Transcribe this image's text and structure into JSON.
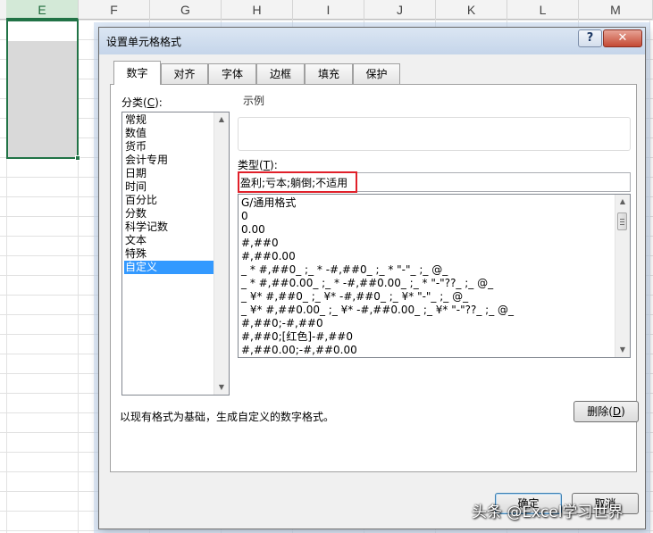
{
  "spreadsheet": {
    "columns": [
      "E",
      "F",
      "G",
      "H",
      "I",
      "J",
      "K",
      "L",
      "M"
    ],
    "selected_column": "E"
  },
  "dialog": {
    "title": "设置单元格格式",
    "help_label": "?",
    "close_label": "✕",
    "tabs": [
      {
        "label": "数字",
        "active": true
      },
      {
        "label": "对齐",
        "active": false
      },
      {
        "label": "字体",
        "active": false
      },
      {
        "label": "边框",
        "active": false
      },
      {
        "label": "填充",
        "active": false
      },
      {
        "label": "保护",
        "active": false
      }
    ],
    "category_label": "分类(",
    "category_hotkey": "C",
    "category_label_end": "):",
    "categories": [
      "常规",
      "数值",
      "货币",
      "会计专用",
      "日期",
      "时间",
      "百分比",
      "分数",
      "科学记数",
      "文本",
      "特殊",
      "自定义"
    ],
    "selected_category": "自定义",
    "sample_label": "示例",
    "type_label": "类型(",
    "type_hotkey": "T",
    "type_label_end": "):",
    "type_value": "盈利;亏本;躺倒;不适用",
    "formats": [
      "G/通用格式",
      "0",
      "0.00",
      "#,##0",
      "#,##0.00",
      "_ * #,##0_ ;_ * -#,##0_ ;_ * \"-\"_ ;_ @_",
      "_ * #,##0.00_ ;_ * -#,##0.00_ ;_ * \"-\"??_ ;_ @_",
      "_ ¥* #,##0_ ;_ ¥* -#,##0_ ;_ ¥* \"-\"_ ;_ @_",
      "_ ¥* #,##0.00_ ;_ ¥* -#,##0.00_ ;_ ¥* \"-\"??_ ;_ @_",
      "#,##0;-#,##0",
      "#,##0;[红色]-#,##0",
      "#,##0.00;-#,##0.00"
    ],
    "delete_label": "删除(",
    "delete_hotkey": "D",
    "delete_label_end": ")",
    "description": "以现有格式为基础，生成自定义的数字格式。",
    "ok_label": "确定",
    "cancel_label": "取消"
  },
  "watermark": "头条 @Excel学习世界",
  "colors": {
    "selection_blue": "#3399ff",
    "highlight_red": "#e0202a",
    "excel_green": "#217346"
  }
}
